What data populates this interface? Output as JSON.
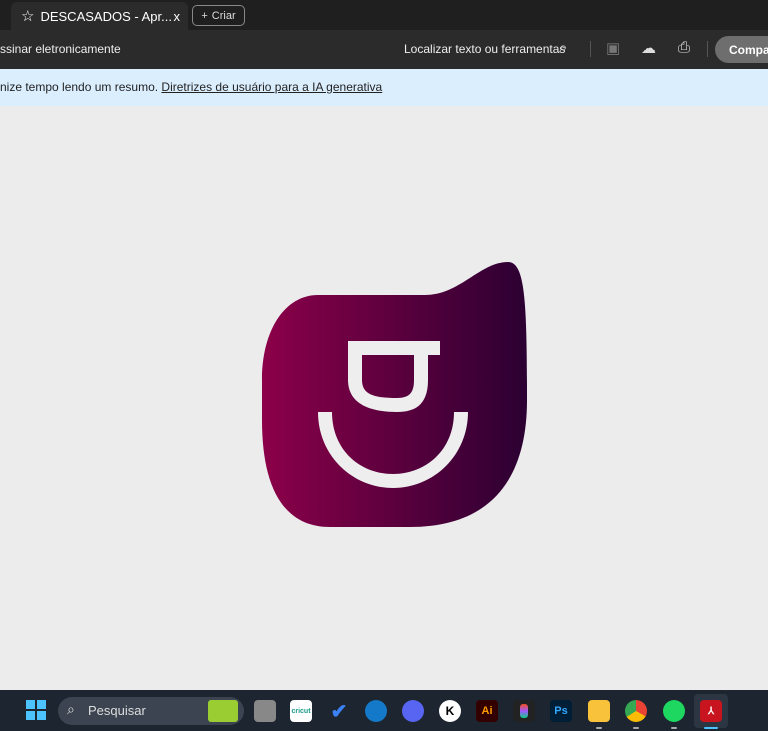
{
  "tab": {
    "title": "DESCASADOS - Apr...",
    "close": "x",
    "new_label": "Criar"
  },
  "toolbar": {
    "left": "ssinar eletronicamente",
    "find": "Localizar texto ou ferramentas",
    "share": "Compar"
  },
  "banner": {
    "text": "nize tempo lendo um resumo. ",
    "link": "Diretrizes de usuário para a IA generativa"
  },
  "taskbar": {
    "search": "Pesquisar",
    "apps": [
      "cricut",
      "Ai",
      "Ps",
      "K"
    ]
  },
  "colors": {
    "logo_left": "#8c0049",
    "logo_right": "#2b0032"
  }
}
